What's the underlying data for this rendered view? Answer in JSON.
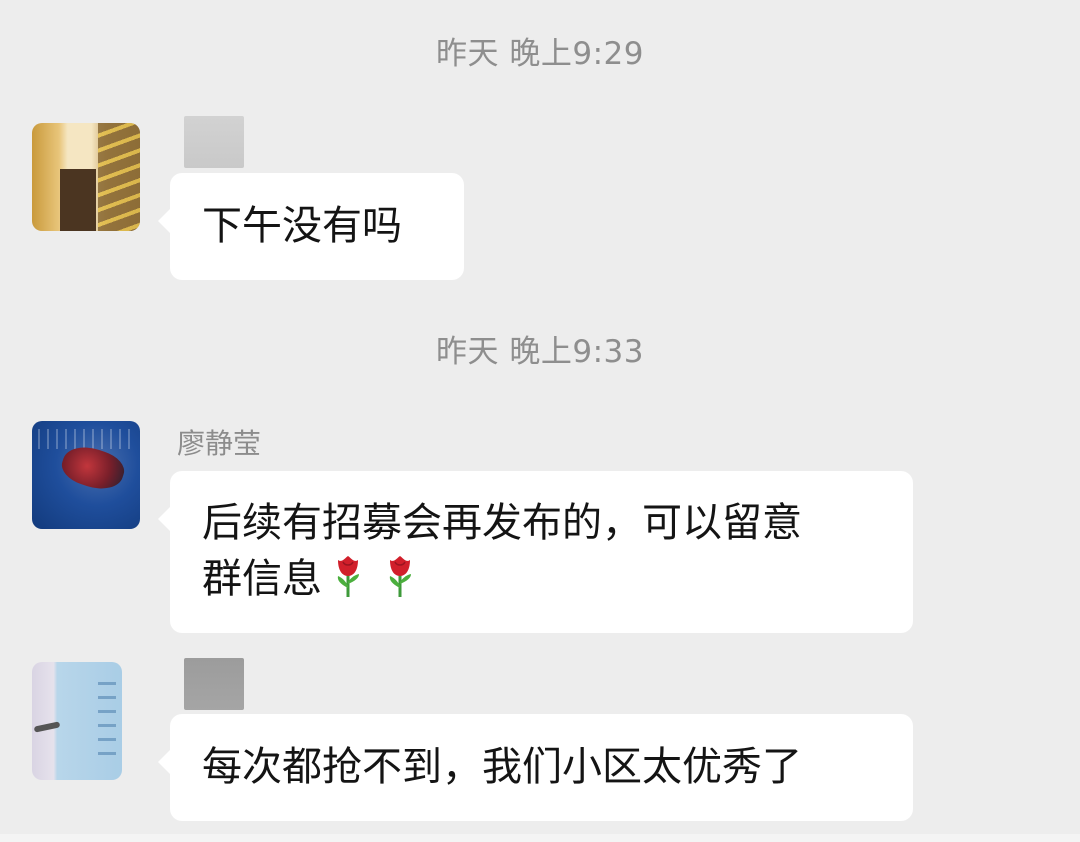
{
  "timestamps": {
    "t1": "昨天 晚上9:29",
    "t2": "昨天 晚上9:33"
  },
  "messages": [
    {
      "sender": "",
      "text": "下午没有吗"
    },
    {
      "sender": "廖静莹",
      "text_line1": "后续有招募会再发布的，可以留意",
      "text_line2": "群信息",
      "emoji": [
        "rose-icon",
        "rose-icon"
      ]
    },
    {
      "sender": "",
      "text": "每次都抢不到，我们小区太优秀了"
    }
  ],
  "colors": {
    "background": "#ededed",
    "bubble": "#ffffff",
    "timestamp_text": "#8e8e8e",
    "name_text": "#8c8c8c",
    "message_text": "#141414"
  }
}
